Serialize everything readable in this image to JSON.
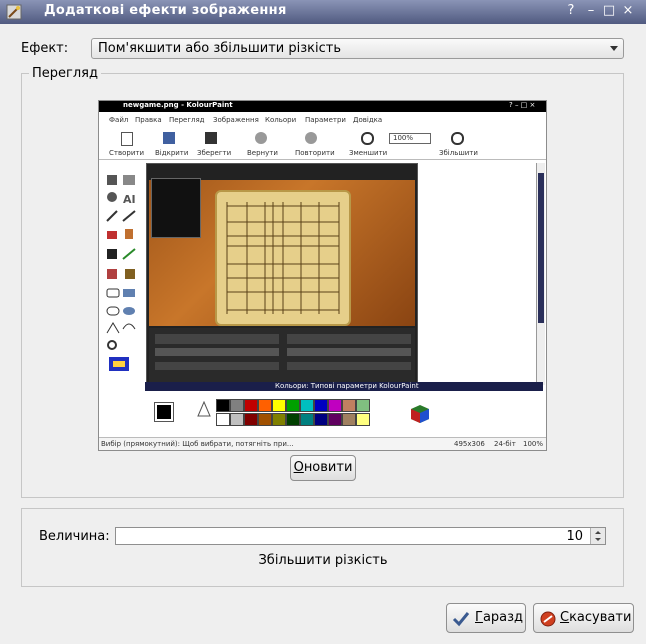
{
  "window": {
    "title": "Додаткові ефекти зображення",
    "buttons": [
      "?",
      "–",
      "□",
      "×"
    ]
  },
  "effect": {
    "label": "Ефект:",
    "selected": "Пом'якшити або збільшити різкість"
  },
  "preview_group": {
    "legend": "Перегляд",
    "update_button": "Оновити"
  },
  "preview_image": {
    "title": "newgame.png - KolourPaint",
    "menu": [
      "Файл",
      "Правка",
      "Перегляд",
      "Зображення",
      "Кольори",
      "Параметри",
      "Довідка"
    ],
    "toolbar": [
      "Створити",
      "Відкрити",
      "Зберегти",
      "Вернути",
      "Повторити",
      "Зменшити",
      "Збільшити"
    ],
    "zoom": "100%",
    "palette_title": "Кольори: Типові параметри KolourPaint",
    "status_left": "Вибір (прямокутний): Щоб вибрати, потягніть при...",
    "status_size": "495x306",
    "status_depth": "24-біт",
    "status_zoom": "100%",
    "palette_colors": [
      "#000000",
      "#808080",
      "#c00000",
      "#ff6000",
      "#ffff00",
      "#00a000",
      "#00c0c0",
      "#0000c0",
      "#c000c0",
      "#c08060",
      "#80c080",
      "#ffffff",
      "#c0c0c0",
      "#800000",
      "#a05000",
      "#808000",
      "#004000",
      "#008080",
      "#000080",
      "#600060",
      "#a08060",
      "#ffff80"
    ]
  },
  "amount": {
    "label": "Величина:",
    "value": "10",
    "description": "Збільшити різкість"
  },
  "footer": {
    "ok": "Гаразд",
    "cancel": "Скасувати"
  }
}
